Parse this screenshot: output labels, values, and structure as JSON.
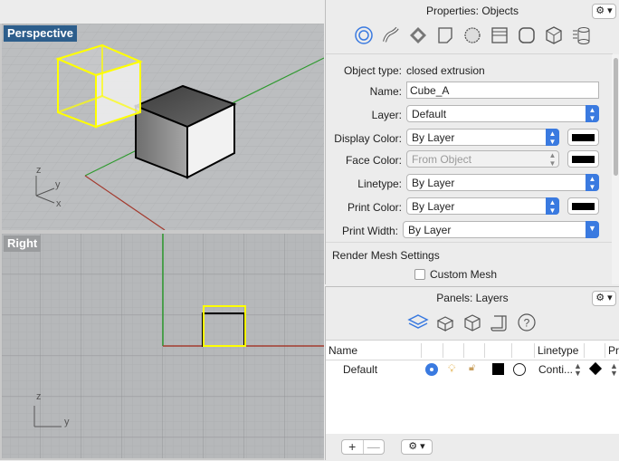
{
  "viewports": {
    "perspective_label": "Perspective",
    "right_label": "Right",
    "axis_z": "z",
    "axis_y": "y",
    "axis_x": "x"
  },
  "properties": {
    "title": "Properties: Objects",
    "gear": "⚙︎ ▾",
    "tabs": [
      "object-tab",
      "curve-tab",
      "material-tab",
      "page-tab",
      "decal-tab",
      "section-tab",
      "round-tab",
      "mesh-tab",
      "database-tab"
    ],
    "object_type_label": "Object type:",
    "object_type_value": "closed extrusion",
    "name_label": "Name:",
    "name_value": "Cube_A",
    "layer_label": "Layer:",
    "layer_value": "Default",
    "display_color_label": "Display Color:",
    "display_color_value": "By Layer",
    "face_color_label": "Face Color:",
    "face_color_value": "From Object",
    "linetype_label": "Linetype:",
    "linetype_value": "By Layer",
    "print_color_label": "Print Color:",
    "print_color_value": "By Layer",
    "print_width_label": "Print Width:",
    "print_width_value": "By Layer",
    "render_mesh_label": "Render Mesh Settings",
    "custom_mesh_label": "Custom Mesh",
    "swatch_color": "#000000"
  },
  "layers": {
    "title": "Panels: Layers",
    "gear": "⚙︎ ▾",
    "col_name": "Name",
    "col_linetype": "Linetype",
    "col_pr": "Pr",
    "rows": [
      {
        "name": "Default",
        "linetype": "Conti..."
      }
    ],
    "plus": "+",
    "minus": "—",
    "footer_gear": "⚙︎ ▾"
  },
  "colors": {
    "accent": "#3a7ae0",
    "selection": "#ffff00",
    "x_axis": "#a33a2e",
    "y_axis": "#2f9a2f"
  }
}
